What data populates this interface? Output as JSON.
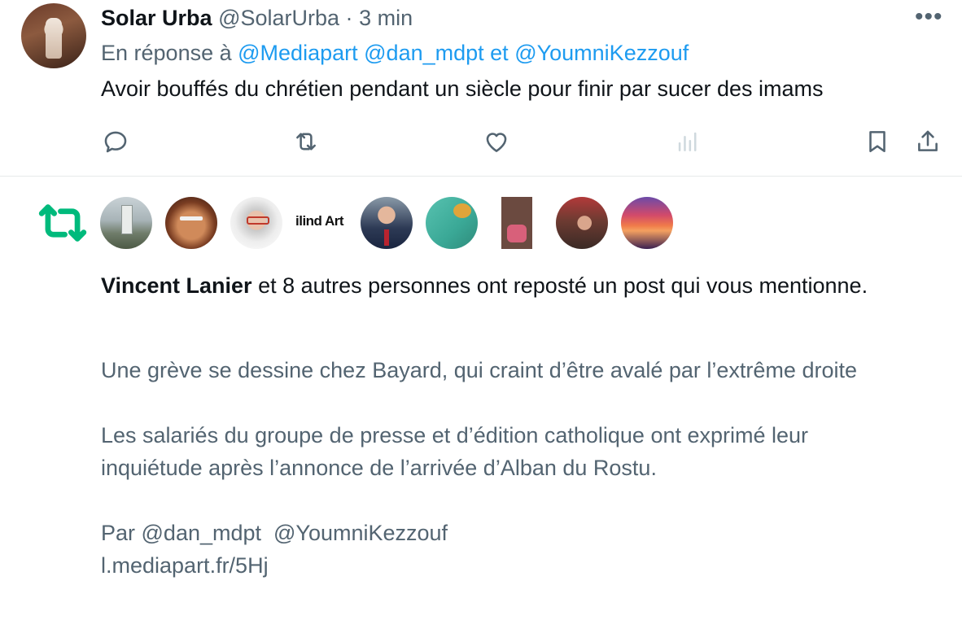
{
  "tweet": {
    "author_name": "Solar Urba",
    "handle": "@SolarUrba",
    "separator": "·",
    "time": "3 min",
    "more_label": "•••",
    "reply_prefix": "En réponse à",
    "reply_mention_1": "@Mediapart",
    "reply_mention_2": "@dan_mdpt",
    "reply_conjunction": "et",
    "reply_mention_3": "@YoumniKezzouf",
    "text": "Avoir bouffés du chrétien pendant un siècle pour finir par sucer des imams",
    "actions": [
      "reply-icon",
      "retweet-icon",
      "like-icon",
      "views-icon",
      "bookmark-icon",
      "share-icon"
    ]
  },
  "notification": {
    "type_icon": "retweet-icon",
    "accent_color": "#00ba7c",
    "reposter_name": "Vincent Lanier",
    "summary_rest": "et 8 autres personnes ont reposté un post qui vous mentionne.",
    "avatar_logo_text": "ilind Art",
    "quoted_paragraph_1": "Une grève se dessine chez Bayard, qui craint d’être avalé par l’extrême droite",
    "quoted_paragraph_2": "Les salariés du groupe de presse et d’édition catholique ont exprimé leur inquiétude après l’annonce de l’arrivée d’Alban du Rostu.",
    "quoted_by_line": "Par @dan_mdpt  @YoumniKezzouf",
    "quoted_link": "l.mediapart.fr/5Hj"
  },
  "colors": {
    "text": "#0f1419",
    "muted": "#536471",
    "link": "#1d9bf0",
    "border": "#e7e9ea"
  }
}
